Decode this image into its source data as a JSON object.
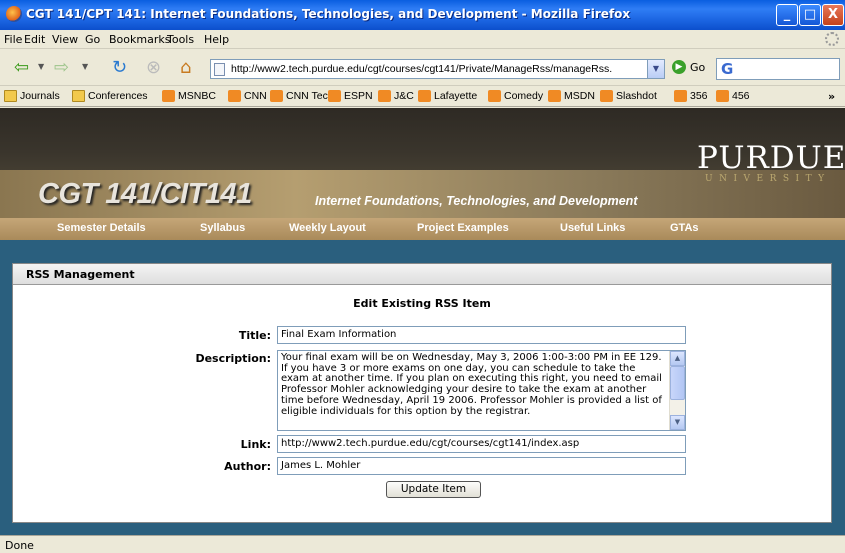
{
  "window": {
    "title": "CGT 141/CPT 141: Internet Foundations, Technologies, and Development - Mozilla Firefox",
    "minimize_glyph": "_",
    "maximize_glyph": "□",
    "close_glyph": "X"
  },
  "menubar": {
    "items": [
      "File",
      "Edit",
      "View",
      "Go",
      "Bookmarks",
      "Tools",
      "Help"
    ]
  },
  "toolbar": {
    "url": "http://www2.tech.purdue.edu/cgt/courses/cgt141/Private/ManageRss/manageRss.",
    "go_label": "Go",
    "search_glyph": "G"
  },
  "bookmarks": {
    "items": [
      {
        "label": "Journals",
        "icon": "folder-icon"
      },
      {
        "label": "Conferences",
        "icon": "folder-icon"
      },
      {
        "label": "MSNBC",
        "icon": "rss-icon"
      },
      {
        "label": "CNN",
        "icon": "rss-icon"
      },
      {
        "label": "CNN Tech",
        "icon": "rss-icon"
      },
      {
        "label": "ESPN",
        "icon": "rss-icon"
      },
      {
        "label": "J&C",
        "icon": "rss-icon"
      },
      {
        "label": "Lafayette",
        "icon": "rss-icon"
      },
      {
        "label": "Comedy",
        "icon": "rss-icon"
      },
      {
        "label": "MSDN",
        "icon": "rss-icon"
      },
      {
        "label": "Slashdot",
        "icon": "rss-icon"
      },
      {
        "label": "356",
        "icon": "rss-icon"
      },
      {
        "label": "456",
        "icon": "rss-icon"
      }
    ],
    "more": "»"
  },
  "site": {
    "university": "PURDUE",
    "university_sub": "UNIVERSITY",
    "course_title": "CGT 141/CIT141",
    "course_subtitle": "Internet Foundations, Technologies, and Development",
    "nav": [
      "Semester Details",
      "Syllabus",
      "Weekly Layout",
      "Project Examples",
      "Useful Links",
      "GTAs"
    ]
  },
  "panel": {
    "heading": "RSS Management",
    "form_title": "Edit Existing RSS Item",
    "title_label": "Title:",
    "title_value": "Final Exam Information",
    "description_label": "Description:",
    "description_value": "Your final exam will be on Wednesday, May 3, 2006 1:00-3:00 PM in EE 129. If you have 3 or more exams on one day, you can schedule to take the exam at another time. If you plan on executing this right, you need to email Professor Mohler acknowledging your desire to take the exam at another time before Wednesday, April 19 2006. Professor Mohler is provided a list of eligible individuals for this option by the registrar.",
    "link_label": "Link:",
    "link_value": "http://www2.tech.purdue.edu/cgt/courses/cgt141/index.asp",
    "author_label": "Author:",
    "author_value": "James L. Mohler",
    "update_button": "Update Item"
  },
  "status": {
    "text": "Done"
  }
}
